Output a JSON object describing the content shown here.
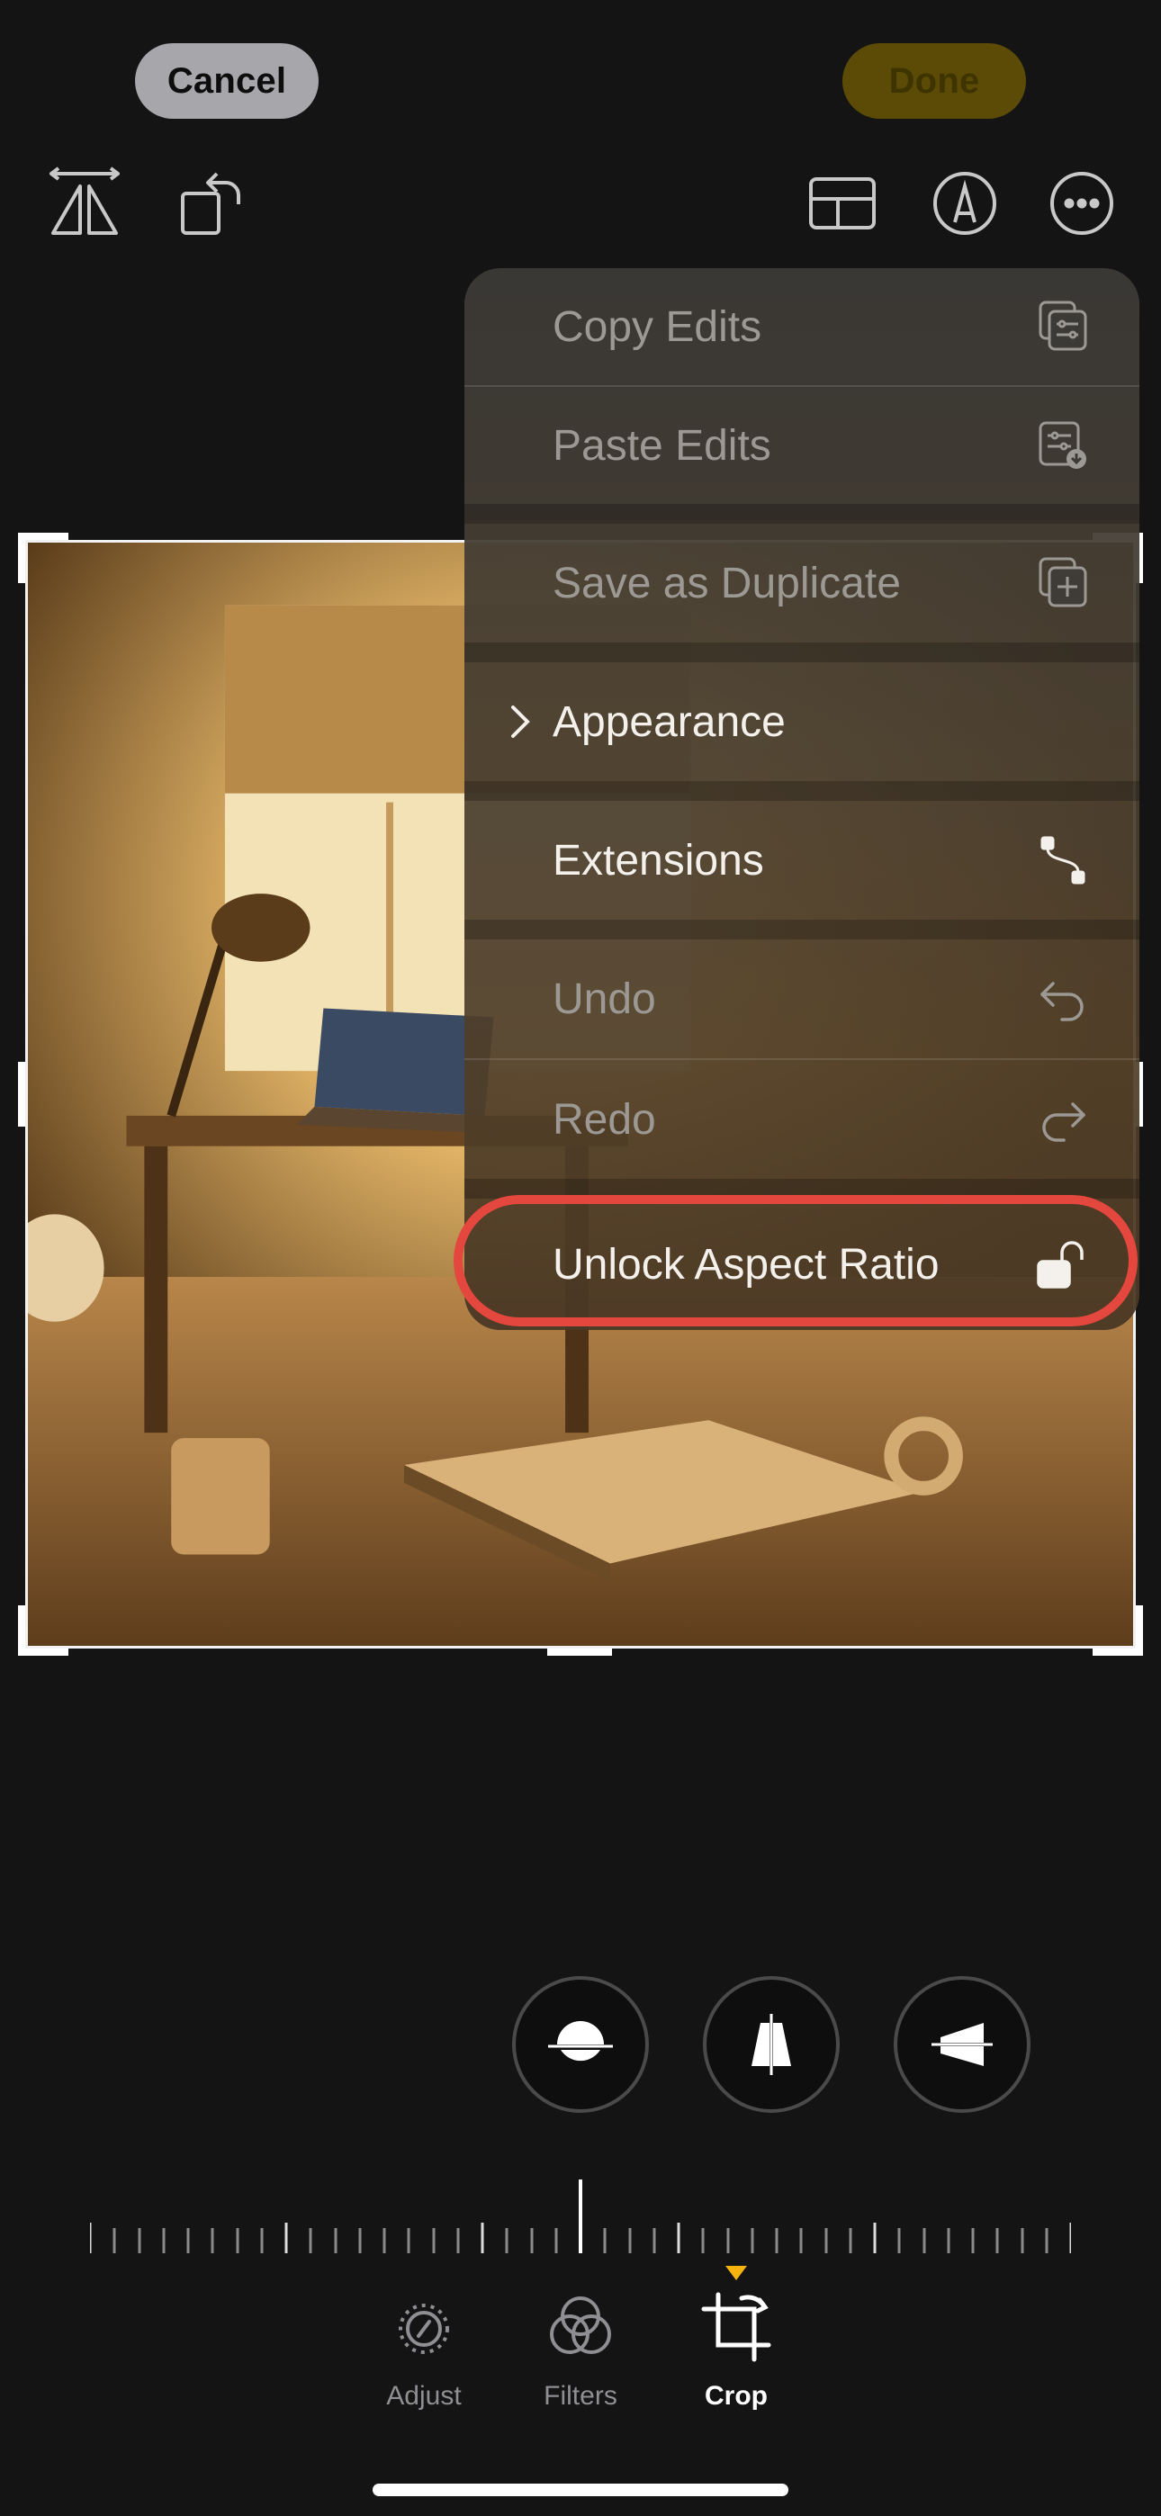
{
  "top_bar": {
    "cancel_label": "Cancel",
    "done_label": "Done",
    "icons": [
      "flip-horizontal-icon",
      "rotate-icon",
      "aspect-ratio-icon",
      "markup-icon",
      "more-icon"
    ]
  },
  "menu": {
    "items": [
      {
        "label": "Copy Edits",
        "icon": "copy-edits-icon",
        "enabled": false
      },
      {
        "label": "Paste Edits",
        "icon": "paste-edits-icon",
        "enabled": false
      },
      {
        "label": "Save as Duplicate",
        "icon": "duplicate-icon",
        "enabled": false
      },
      {
        "label": "Appearance",
        "icon": "chevron-right-icon",
        "enabled": true
      },
      {
        "label": "Extensions",
        "icon": "extensions-icon",
        "enabled": true
      },
      {
        "label": "Undo",
        "icon": "undo-icon",
        "enabled": false
      },
      {
        "label": "Redo",
        "icon": "redo-icon",
        "enabled": false
      },
      {
        "label": "Unlock Aspect Ratio",
        "icon": "unlock-icon",
        "enabled": true,
        "highlighted": true
      }
    ],
    "highlight_color": "#e4473e"
  },
  "tools": [
    "straighten-icon",
    "vertical-perspective-icon",
    "horizontal-perspective-icon"
  ],
  "tabs": [
    {
      "label": "Adjust",
      "icon": "adjust-icon",
      "active": false
    },
    {
      "label": "Filters",
      "icon": "filters-icon",
      "active": false
    },
    {
      "label": "Crop",
      "icon": "crop-icon",
      "active": true
    }
  ],
  "colors": {
    "accent": "#f6b30f",
    "done_bg": "#5b4b06"
  }
}
